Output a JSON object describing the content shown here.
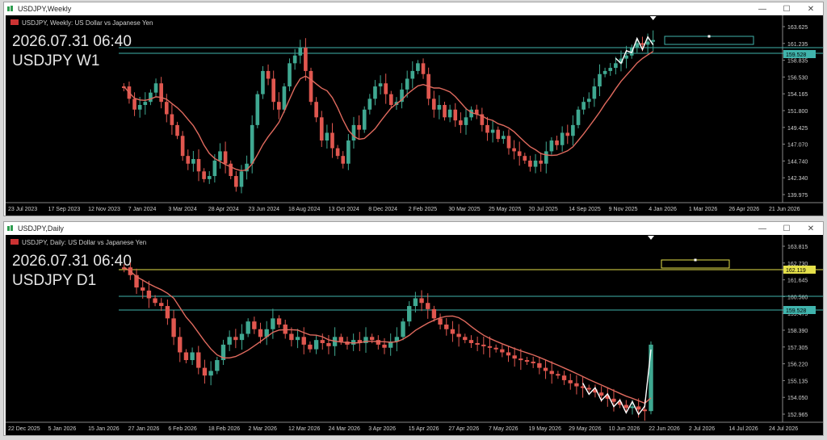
{
  "colors": {
    "background": "#000000",
    "bull": "#3fa891",
    "bear": "#e0574f",
    "ma": "#e06a5e",
    "hline_cyan": "#40b4ad",
    "hline_yellow": "#e5e04a",
    "text": "#cfcfcf",
    "zigzag": "#ffffff"
  },
  "windows": [
    {
      "id": "weekly",
      "title": "USDJPY,Weekly",
      "caption": "USDJPY, Weekly:  US Dollar vs Japanese Yen",
      "overlay_time": "2026.07.31 06:40",
      "overlay_symbol": "USDJPY W1",
      "price_labels": [
        "163.625",
        "161.235",
        "158.835",
        "156.530",
        "154.165",
        "151.800",
        "149.425",
        "147.070",
        "144.740",
        "142.340",
        "139.975"
      ],
      "date_labels": [
        "23 Jul 2023",
        "17 Sep 2023",
        "12 Nov 2023",
        "7 Jan 2024",
        "3 Mar 2024",
        "28 Apr 2024",
        "23 Jun 2024",
        "18 Aug 2024",
        "13 Oct 2024",
        "8 Dec 2024",
        "2 Feb 2025",
        "30 Mar 2025",
        "25 May 2025",
        "20 Jul 2025",
        "14 Sep 2025",
        "9 Nov 2025",
        "4 Jan 2026",
        "1 Mar 2026",
        "26 Apr 2026",
        "21 Jun 2026"
      ],
      "badges": [
        {
          "text": "159.528",
          "color": "#40b4ad"
        }
      ]
    },
    {
      "id": "daily",
      "title": "USDJPY,Daily",
      "caption": "USDJPY, Daily:  US Dollar vs Japanese Yen",
      "overlay_time": "2026.07.31 06:40",
      "overlay_symbol": "USDJPY D1",
      "price_labels": [
        "163.815",
        "162.730",
        "161.645",
        "160.560",
        "159.475",
        "158.390",
        "157.305",
        "156.220",
        "155.135",
        "154.050",
        "152.965"
      ],
      "date_labels": [
        "22 Dec 2025",
        "5 Jan 2026",
        "15 Jan 2026",
        "27 Jan 2026",
        "6 Feb 2026",
        "18 Feb 2026",
        "2 Mar 2026",
        "12 Mar 2026",
        "24 Mar 2026",
        "3 Apr 2026",
        "15 Apr 2026",
        "27 Apr 2026",
        "7 May 2026",
        "19 May 2026",
        "29 May 2026",
        "10 Jun 2026",
        "22 Jun 2026",
        "2 Jul 2026",
        "14 Jul 2026",
        "24 Jul 2026"
      ],
      "badges": [
        {
          "text": "162.119",
          "color": "#e5e04a"
        },
        {
          "text": "159.528",
          "color": "#40b4ad"
        }
      ]
    }
  ]
}
